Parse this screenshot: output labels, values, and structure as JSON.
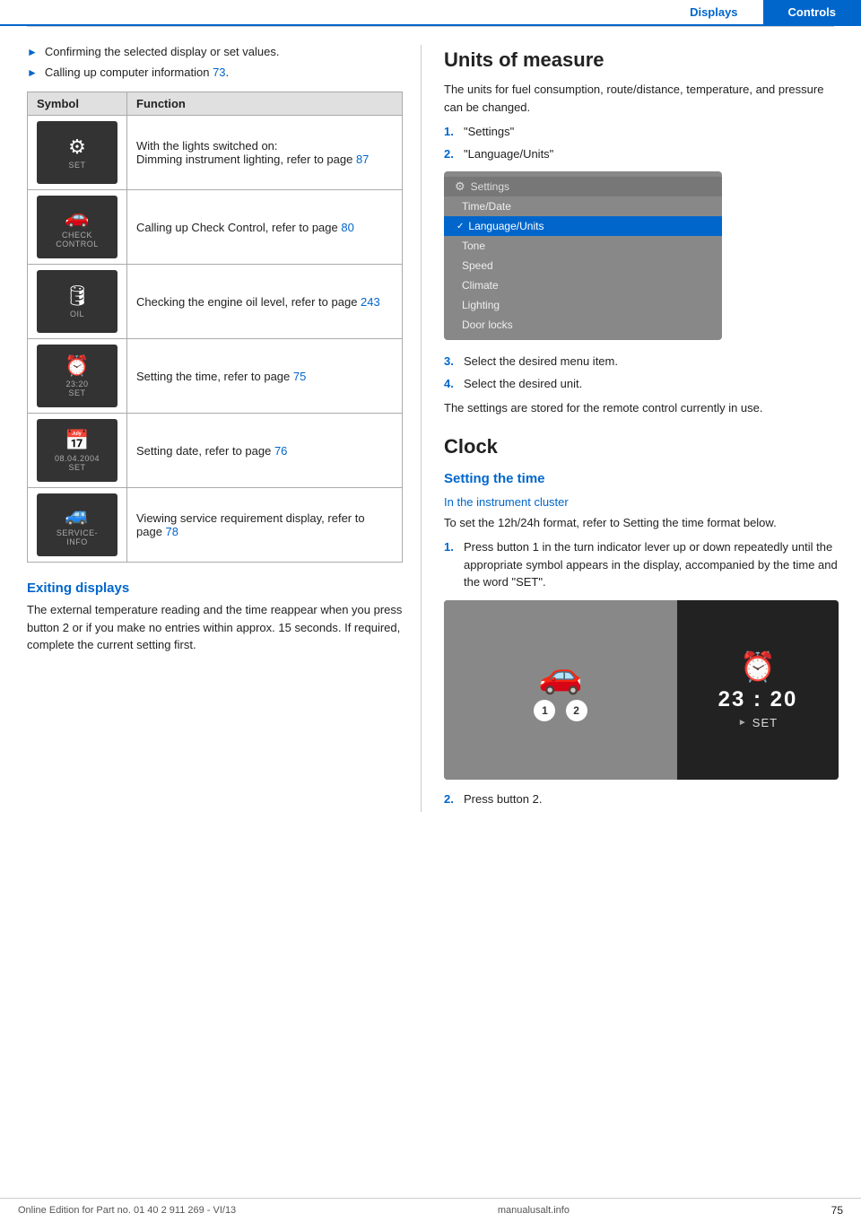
{
  "header": {
    "tab_displays": "Displays",
    "tab_controls": "Controls"
  },
  "left": {
    "bullet1": "Confirming the selected display or set values.",
    "bullet2_prefix": "Calling up computer information",
    "bullet2_link": "73",
    "bullet2_suffix": ".",
    "table": {
      "col1": "Symbol",
      "col2": "Function",
      "rows": [
        {
          "symbol_icon": "⚙",
          "symbol_label": "SET",
          "function_line1": "With the lights switched on:",
          "function_line2": "Dimming instrument lighting, refer to page",
          "function_link": "87",
          "function_link2": null
        },
        {
          "symbol_icon": "🚗",
          "symbol_label": "CHECK\nCONTROL",
          "function_line1": "Calling up Check Control, refer to page",
          "function_link": "80",
          "function_link2": null
        },
        {
          "symbol_icon": "🛢",
          "symbol_label": "OIL",
          "function_line1": "Checking the engine oil level, refer to page",
          "function_link": "243",
          "function_link2": null
        },
        {
          "symbol_icon": "⏰",
          "symbol_label": "23 : 20\nSET",
          "function_line1": "Setting the time, refer to page",
          "function_link": "75",
          "function_link2": null
        },
        {
          "symbol_icon": "📅",
          "symbol_label": "08.04.2004\nSET",
          "function_line1": "Setting date, refer to page",
          "function_link": "76",
          "function_link2": null
        },
        {
          "symbol_icon": "🚙",
          "symbol_label": "SERVICE-\nINFO",
          "function_line1": "Viewing service requirement display, refer to page",
          "function_link": "78",
          "function_link2": null
        }
      ]
    },
    "exiting_heading": "Exiting displays",
    "exiting_text": "The external temperature reading and the time reappear when you press button 2 or if you make no entries within approx. 15 seconds. If required, complete the current setting first."
  },
  "right": {
    "units_heading": "Units of measure",
    "units_body": "The units for fuel consumption, route/distance, temperature, and pressure can be changed.",
    "units_steps": [
      {
        "num": "1.",
        "text": "\"Settings\""
      },
      {
        "num": "2.",
        "text": "\"Language/Units\""
      }
    ],
    "settings_screenshot": {
      "title": "Settings",
      "items": [
        "Time/Date",
        "Language/Units",
        "Tone",
        "Speed",
        "Climate",
        "Lighting",
        "Door locks"
      ],
      "selected": "Language/Units"
    },
    "units_steps2": [
      {
        "num": "3.",
        "text": "Select the desired menu item."
      },
      {
        "num": "4.",
        "text": "Select the desired unit."
      }
    ],
    "units_note": "The settings are stored for the remote control currently in use.",
    "clock_heading": "Clock",
    "clock_sub1": "Setting the time",
    "clock_sub2": "In the instrument cluster",
    "clock_body1": "To set the 12h/24h format, refer to Setting the time format below.",
    "clock_steps": [
      {
        "num": "1.",
        "text": "Press button 1 in the turn indicator lever up or down repeatedly until the appropriate symbol appears in the display, accompanied by the time and the word \"SET\"."
      }
    ],
    "clock_time": "23 : 20",
    "clock_set": "SET",
    "clock_step2": "2.",
    "clock_step2_text": "Press button 2."
  },
  "footer": {
    "text": "Online Edition for Part no. 01 40 2 911 269 - VI/13",
    "page": "75",
    "site": "manualusalt.info"
  }
}
